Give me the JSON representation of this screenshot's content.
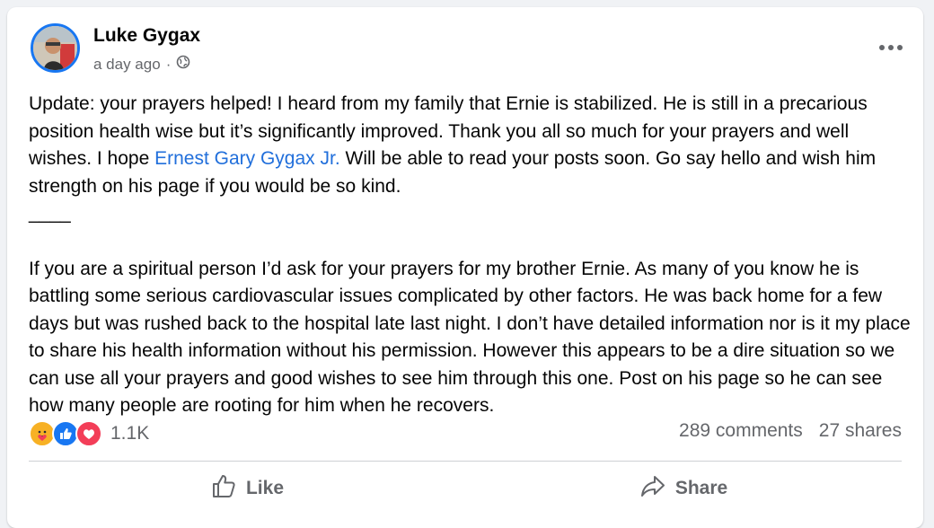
{
  "post": {
    "author": "Luke Gygax",
    "time": "a day ago",
    "separator": "·",
    "audience_icon": "globe-icon",
    "more_icon": "more-options-icon",
    "update": {
      "before_link": "Update: your prayers helped! I heard from my family that Ernie is stabilized. He is still in a precarious position health wise but it’s significantly improved.   Thank you all so much for your prayers and well wishes.   I hope ",
      "link": "Ernest Gary Gygax Jr.",
      "after_link": " Will be able to read your posts soon.  Go say hello and wish him strength on his page if you would be so kind."
    },
    "separator_line": "____",
    "original": "If you are a spiritual person I’d ask for your prayers for my brother Ernie.  As many of you know he is battling some serious cardiovascular issues complicated by other factors.  He was back home for a few days but was rushed back to the hospital late last night.  I don’t have detailed information nor is it my place to share his health information without his permission. However this appears to be a dire situation so we can use all your prayers and good wishes to see him through this one. Post on his page so he can see how many people are rooting for him when he recovers."
  },
  "stats": {
    "reactions": [
      "care",
      "like",
      "love"
    ],
    "reaction_count": "1.1K",
    "comments": "289 comments",
    "shares": "27 shares"
  },
  "actions": {
    "like_label": "Like",
    "share_label": "Share"
  },
  "colors": {
    "link": "#216fdb",
    "care": "#f7b125",
    "like": "#1877f2",
    "love": "#f33e58"
  }
}
